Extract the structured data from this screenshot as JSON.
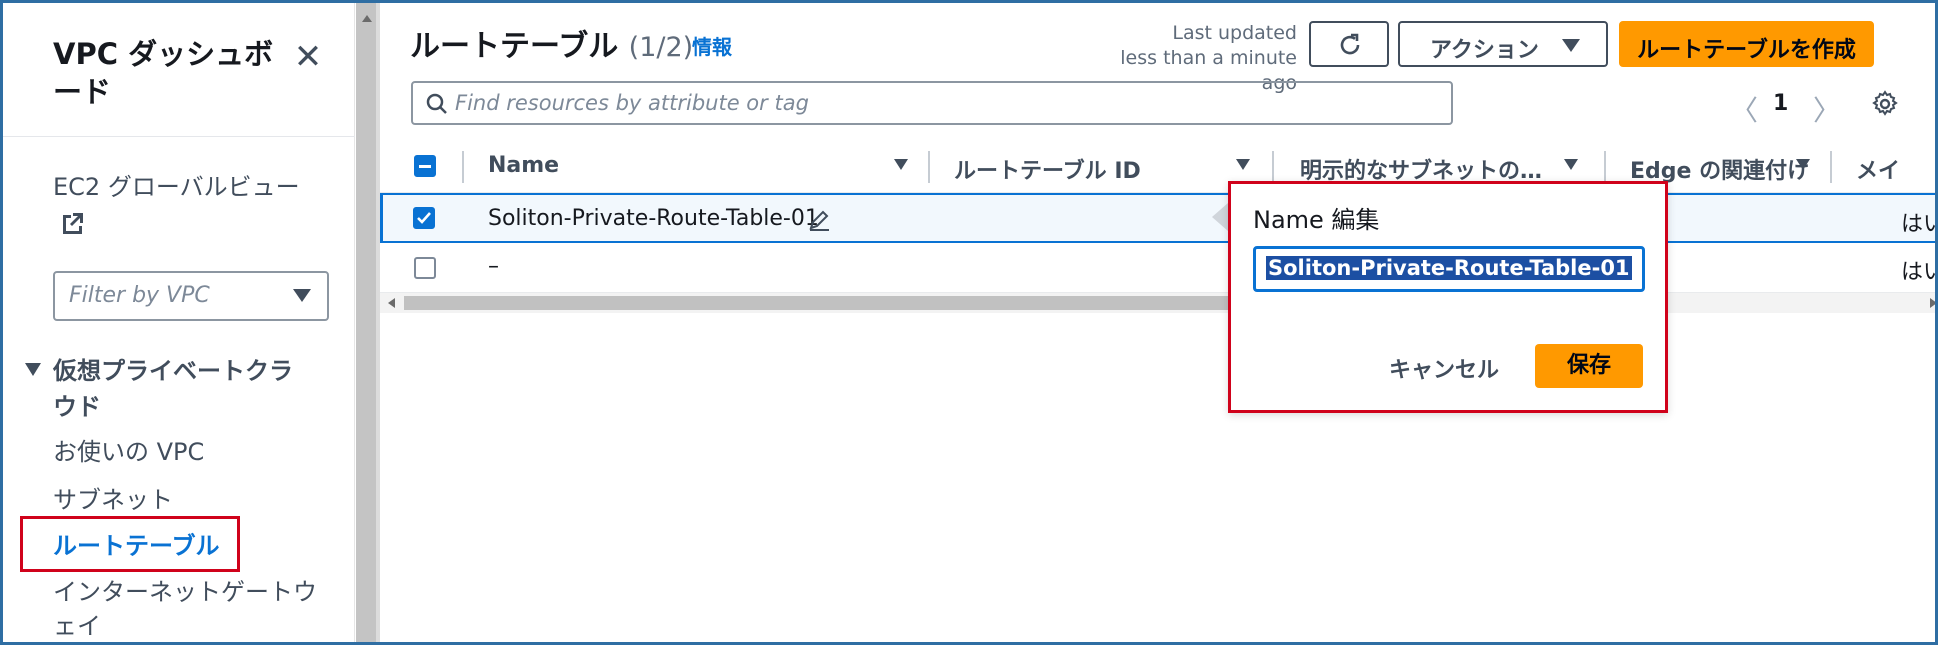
{
  "sidebar": {
    "title": "VPC ダッシュボード",
    "ec2_global_view": "EC2 グローバルビュー",
    "filter_placeholder": "Filter by VPC",
    "section": "仮想プライベートクラウド",
    "items": [
      {
        "label": "お使いの VPC"
      },
      {
        "label": "サブネット"
      },
      {
        "label": "ルートテーブル"
      },
      {
        "label": "インターネットゲートウェイ"
      }
    ]
  },
  "header": {
    "title": "ルートテーブル",
    "count": "(1/2)",
    "info_link": "情報",
    "last_updated_1": "Last updated",
    "last_updated_2": "less than a minute ago",
    "actions_label": "アクション",
    "create_label": "ルートテーブルを作成"
  },
  "search": {
    "placeholder": "Find resources by attribute or tag"
  },
  "pagination": {
    "page": "1"
  },
  "table": {
    "columns": [
      "Name",
      "ルートテーブル ID",
      "明示的なサブネットの…",
      "Edge の関連付け",
      "メイ"
    ],
    "rows": [
      {
        "name": "Soliton-Private-Route-Table-01",
        "subnet": "–",
        "edge": "–",
        "main": "はい",
        "selected": true
      },
      {
        "name": "–",
        "subnet": "–",
        "edge": "–",
        "main": "はい",
        "selected": false
      }
    ]
  },
  "popover": {
    "title": "Name 編集",
    "input_value": "Soliton-Private-Route-Table-01",
    "cancel_label": "キャンセル",
    "save_label": "保存"
  },
  "colors": {
    "primary": "#0972d3",
    "accent_orange": "#ff9900",
    "highlight_red": "#d0021b"
  }
}
